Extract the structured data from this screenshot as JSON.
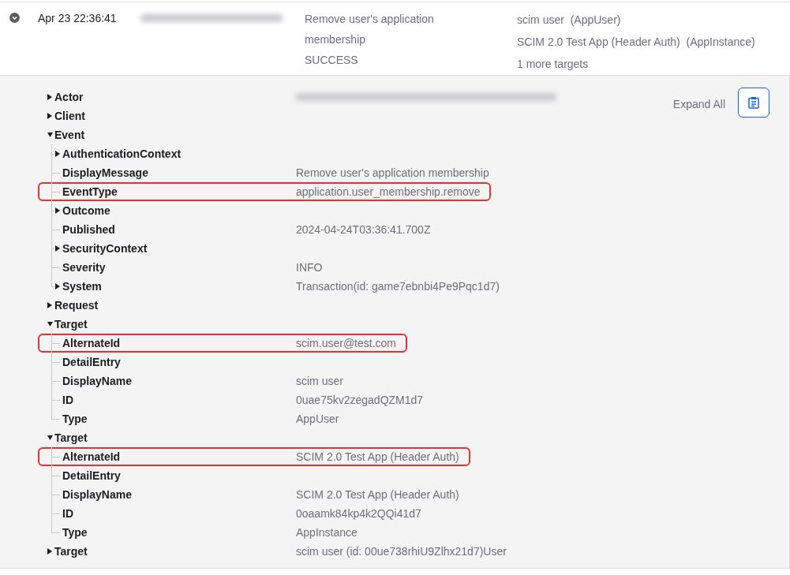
{
  "event_row": {
    "expanded": true,
    "time": "Apr 23 22:36:41",
    "actor": {
      "redacted": true
    },
    "message": "Remove user's application membership",
    "outcome": "SUCCESS",
    "targets": [
      "scim user  (AppUser)",
      "SCIM 2.0 Test App (Header Auth)  (AppInstance)",
      "1 more targets"
    ]
  },
  "details": {
    "expand_all": "Expand All",
    "tree": [
      {
        "label": "Actor",
        "expanded": false,
        "redacted": true,
        "highlighted": false
      },
      {
        "label": "Client",
        "expanded": false,
        "highlighted": false
      },
      {
        "label": "Event",
        "expanded": true,
        "highlighted": false,
        "children": [
          {
            "label": "AuthenticationContext",
            "expanded": false,
            "highlighted": false
          },
          {
            "label": "DisplayMessage",
            "value": "Remove user's application membership",
            "highlighted": false
          },
          {
            "label": "EventType",
            "value": "application.user_membership.remove",
            "highlighted": true
          },
          {
            "label": "Outcome",
            "expanded": false,
            "highlighted": false
          },
          {
            "label": "Published",
            "value": "2024-04-24T03:36:41.700Z",
            "highlighted": false
          },
          {
            "label": "SecurityContext",
            "expanded": false,
            "highlighted": false
          },
          {
            "label": "Severity",
            "value": "INFO",
            "highlighted": false
          },
          {
            "label": "System",
            "expanded": false,
            "value": "Transaction(id: game7ebnbi4Pe9Pqc1d7)",
            "highlighted": false
          }
        ]
      },
      {
        "label": "Request",
        "expanded": false,
        "highlighted": false
      },
      {
        "label": "Target",
        "expanded": true,
        "highlighted": false,
        "children": [
          {
            "label": "AlternateId",
            "value": "scim.user@test.com",
            "highlighted": true
          },
          {
            "label": "DetailEntry",
            "highlighted": false
          },
          {
            "label": "DisplayName",
            "value": "scim user",
            "highlighted": false
          },
          {
            "label": "ID",
            "value": "0uae75kv2zegadQZM1d7",
            "highlighted": false
          },
          {
            "label": "Type",
            "value": "AppUser",
            "highlighted": false
          }
        ]
      },
      {
        "label": "Target",
        "expanded": true,
        "highlighted": false,
        "children": [
          {
            "label": "AlternateId",
            "value": "SCIM 2.0 Test App (Header Auth)",
            "highlighted": true
          },
          {
            "label": "DetailEntry",
            "highlighted": false
          },
          {
            "label": "DisplayName",
            "value": "SCIM 2.0 Test App (Header Auth)",
            "highlighted": false
          },
          {
            "label": "ID",
            "value": "0oaamk84kp4k2QQi41d7",
            "highlighted": false
          },
          {
            "label": "Type",
            "value": "AppInstance",
            "highlighted": false
          }
        ]
      },
      {
        "label": "Target",
        "expanded": false,
        "value": "scim user (id: 00ue738rhiU9Zlhx21d7)User",
        "highlighted": false
      }
    ]
  }
}
